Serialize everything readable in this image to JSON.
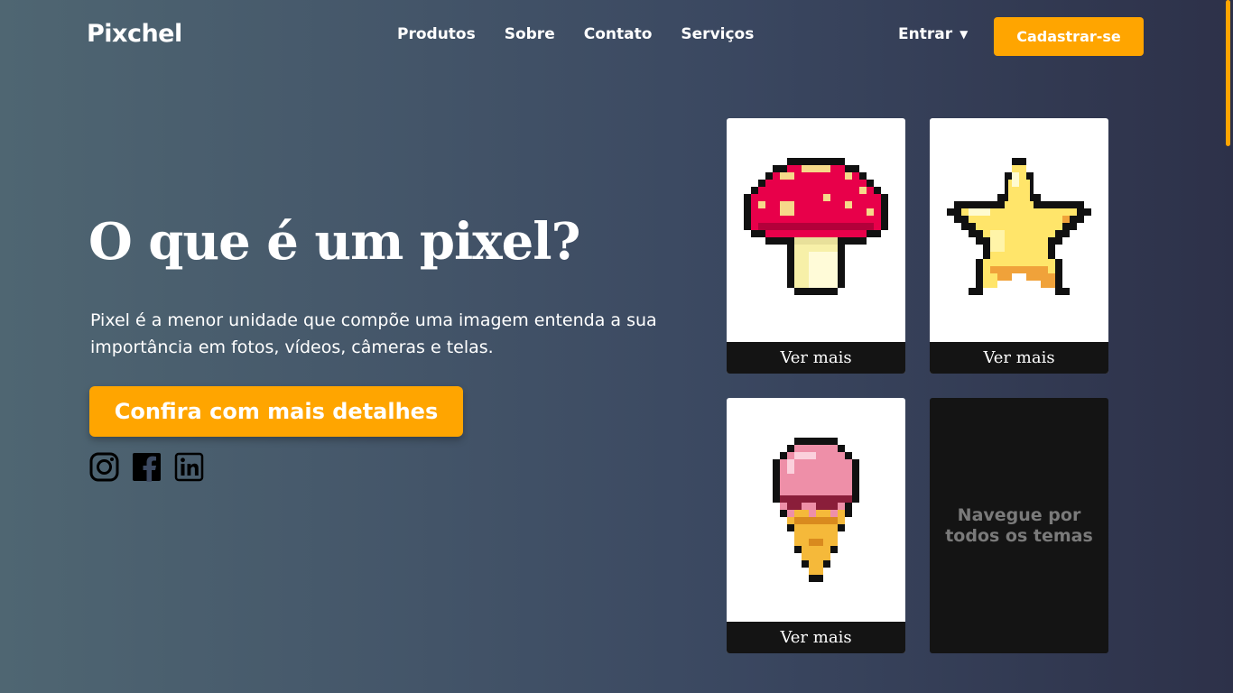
{
  "header": {
    "logo": "Pixchel",
    "nav": [
      "Produtos",
      "Sobre",
      "Contato",
      "Serviços"
    ],
    "login_label": "Entrar",
    "signup_label": "Cadastrar-se"
  },
  "hero": {
    "title": "O que é um pixel?",
    "description": "Pixel é a menor unidade que compõe uma imagem entenda a sua importância em fotos, vídeos, câmeras e telas.",
    "cta_label": "Confira com mais detalhes"
  },
  "social": [
    "instagram-icon",
    "facebook-icon",
    "linkedin-icon"
  ],
  "cards": [
    {
      "image": "mushroom",
      "button": "Ver mais"
    },
    {
      "image": "star",
      "button": "Ver mais"
    },
    {
      "image": "ice-cream",
      "button": "Ver mais"
    }
  ],
  "browse_card": {
    "label": "Navegue por todos os temas"
  },
  "colors": {
    "accent": "#ffa500",
    "card_dark": "#141414",
    "mushroom_red": "#e8004a",
    "star_yellow": "#ffe56a",
    "icecream_pink": "#ee8fa8"
  }
}
